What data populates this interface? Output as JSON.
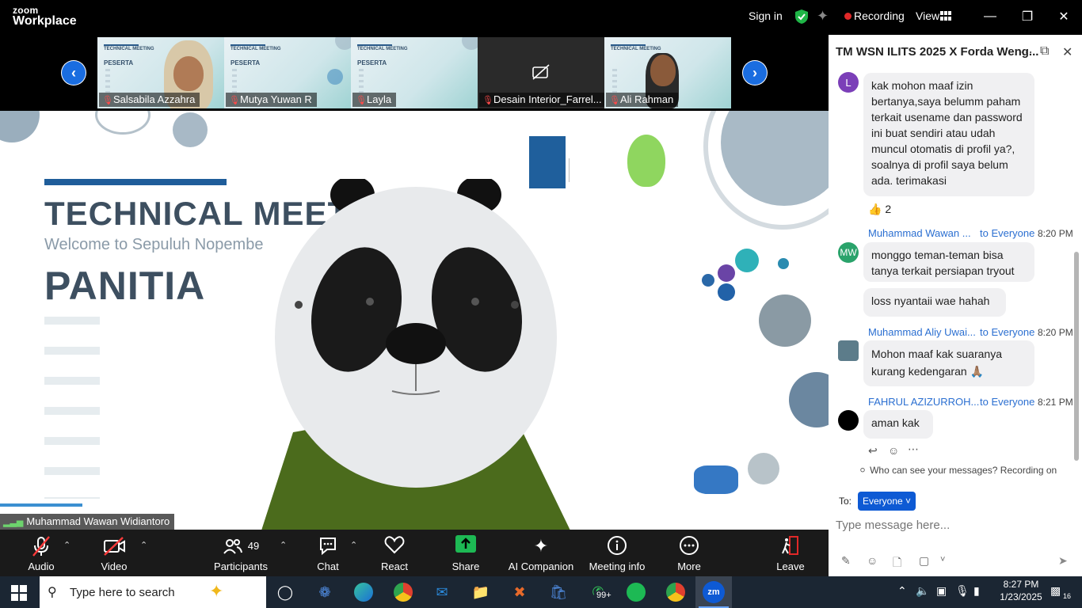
{
  "app": {
    "logo_top": "zoom",
    "logo_bottom": "Workplace",
    "sign_in": "Sign in",
    "recording": "Recording",
    "view": "View"
  },
  "participants_strip": [
    {
      "name": "Salsabila Azzahra",
      "slide_title": "TECHNICAL MEETING",
      "slide_sub": "PESERTA",
      "video": "face"
    },
    {
      "name": "Mutya Yuwan R",
      "slide_title": "TECHNICAL MEETING",
      "slide_sub": "PESERTA",
      "video": "slide"
    },
    {
      "name": "Layla",
      "slide_title": "TECHNICAL MEETING",
      "slide_sub": "PESERTA",
      "video": "slide"
    },
    {
      "name": "Desain Interior_Farrel...",
      "video": "off"
    },
    {
      "name": "Ali Rahman",
      "slide_title": "TECHNICAL MEETING",
      "slide_sub": "PESERTA",
      "video": "face"
    }
  ],
  "main_video": {
    "slide_title": "TECHNICAL MEET",
    "slide_welcome": "Welcome to Sepuluh Nopembe",
    "slide_label": "PANITIA",
    "speaker": "Muhammad Wawan Widiantoro"
  },
  "toolbar": {
    "audio": "Audio",
    "video": "Video",
    "participants": "Participants",
    "participants_count": "49",
    "chat": "Chat",
    "react": "React",
    "share": "Share",
    "ai_companion": "AI Companion",
    "meeting_info": "Meeting info",
    "more": "More",
    "leave": "Leave"
  },
  "chat": {
    "title": "TM WSN ILITS 2025 X Forda Weng...",
    "messages": [
      {
        "avatar": "L",
        "avatar_color": "#7b3fb8",
        "text": "kak mohon maaf izin bertanya,saya belumm paham terkait  usename dan password ini buat sendiri atau udah muncul otomatis di profil ya?, soalnya di profil saya belum ada. terimakasi",
        "reaction": "👍 2"
      },
      {
        "avatar": "MW",
        "avatar_color": "#2aa36b",
        "sender": "Muhammad Wawan ...",
        "to": "to Everyone",
        "time": "8:20 PM",
        "text": "monggo teman-teman bisa tanya terkait persiapan tryout"
      },
      {
        "text": "loss nyantaii wae hahah"
      },
      {
        "sender": "Muhammad Aliy Uwai...",
        "to": "to Everyone",
        "time": "8:20 PM",
        "text": "Mohon maaf kak suaranya kurang kedengaran 🙏🏽"
      },
      {
        "sender": "FAHRUL AZIZURROH...",
        "to": "to Everyone",
        "time": "8:21 PM",
        "text": "aman kak"
      }
    ],
    "privacy_note": "Who can see your messages? Recording on",
    "to_label": "To:",
    "to_value": "Everyone",
    "input_placeholder": "Type message here..."
  },
  "taskbar": {
    "search_placeholder": "Type here to search",
    "whatsapp_badge": "99+",
    "time": "8:27 PM",
    "date": "1/23/2025",
    "notifications": "16"
  },
  "colors": {
    "accent": "#0e5ad4",
    "share_green": "#1db954",
    "recording_red": "#e02828",
    "shield_green": "#1fb547"
  }
}
